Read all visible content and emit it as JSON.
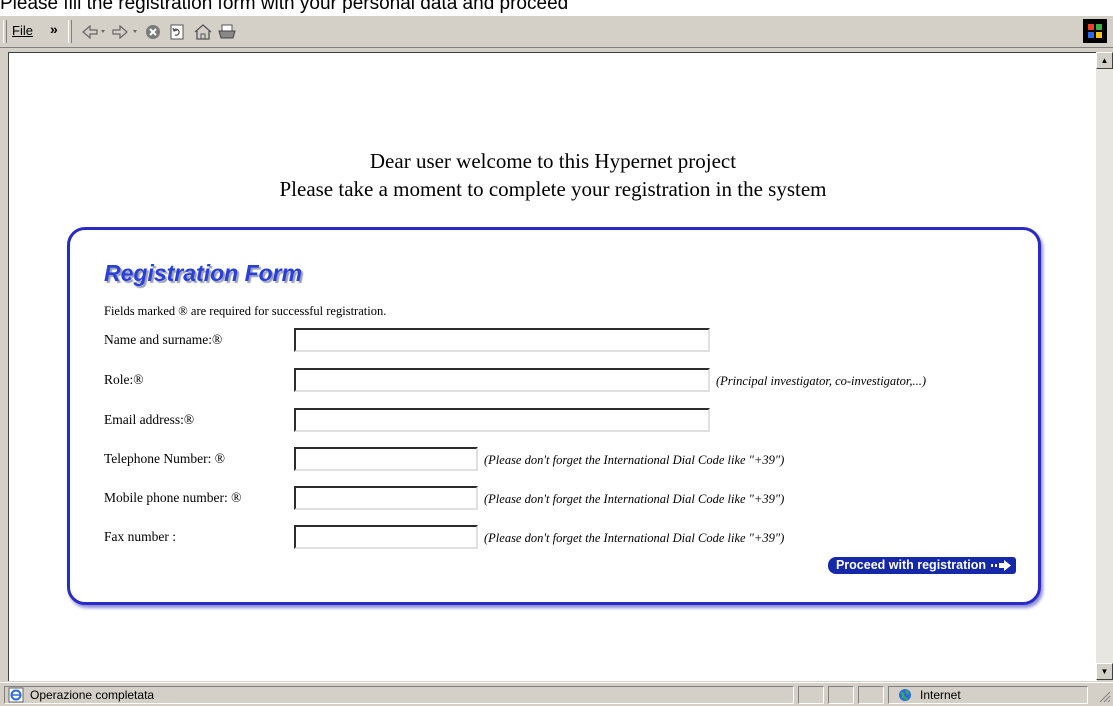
{
  "caption": "Please fill the registration form with your personal data and proceed",
  "toolbar": {
    "menu_file": "File",
    "chevron": "»",
    "buttons": [
      "back-icon",
      "forward-icon",
      "stop-icon",
      "refresh-icon",
      "home-icon",
      "print-icon"
    ]
  },
  "page": {
    "welcome_line1": "Dear user welcome to this Hypernet project",
    "welcome_line2": "Please take a moment to complete your registration in the system"
  },
  "form": {
    "title": "Registration Form",
    "note": "Fields marked ® are required for successful registration.",
    "fields": [
      {
        "label": "Name and surname:®",
        "value": "",
        "hint": ""
      },
      {
        "label": "Role:®",
        "value": "",
        "hint": "(Principal investigator, co-investigator,...)"
      },
      {
        "label": "Email address:®",
        "value": "",
        "hint": ""
      },
      {
        "label": "Telephone Number: ®",
        "value": "",
        "hint": "(Please don't forget the International Dial Code like \"+39\")"
      },
      {
        "label": "Mobile phone number: ®",
        "value": "",
        "hint": "(Please don't forget the International Dial Code like \"+39\")"
      },
      {
        "label": "Fax number :",
        "value": "",
        "hint": "(Please don't forget the International Dial Code like \"+39\")"
      }
    ],
    "submit_label": "Proceed with registration"
  },
  "status": {
    "text": "Operazione completata",
    "zone": "Internet"
  },
  "colors": {
    "accent": "#2a2ac8",
    "title": "#2a3fd8",
    "button": "#1428a8"
  }
}
